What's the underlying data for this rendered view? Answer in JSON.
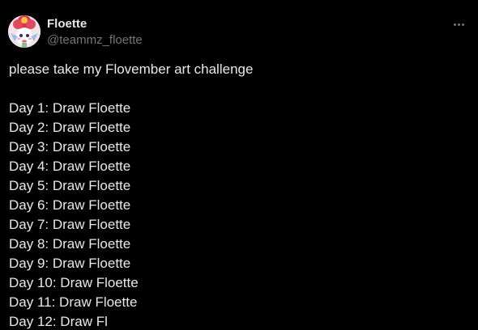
{
  "author": {
    "display_name": "Floette",
    "handle": "@teammz_floette",
    "avatar_icon": "floette-avatar-icon"
  },
  "menu": {
    "icon": "more-horizontal-icon"
  },
  "tweet": {
    "intro": "please take my Flovember art challenge",
    "lines": [
      "Day 1: Draw Floette",
      "Day 2: Draw Floette",
      "Day 3: Draw Floette",
      "Day 4: Draw Floette",
      "Day 5: Draw Floette",
      "Day 6: Draw Floette",
      "Day 7: Draw Floette",
      "Day 8: Draw Floette",
      "Day 9: Draw Floette",
      "Day 10: Draw Floette",
      "Day 11: Draw Floette",
      "Day 12: Draw Fl"
    ]
  },
  "colors": {
    "background": "#000000",
    "text": "#e7e9ea",
    "secondary_text": "#71767b"
  }
}
